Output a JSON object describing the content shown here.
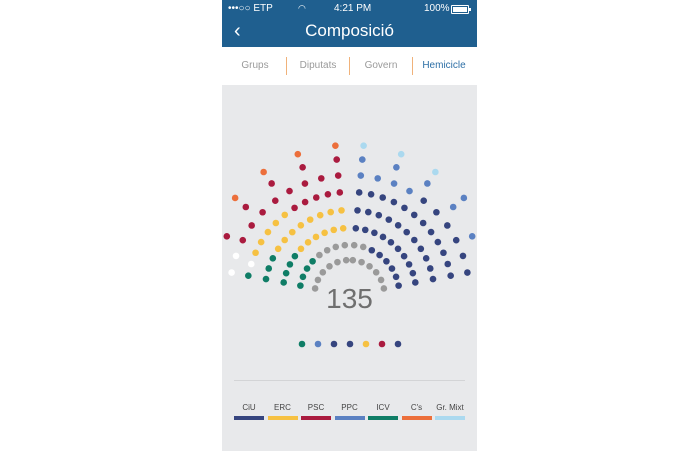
{
  "status_bar": {
    "carrier": "•••○○ ETP",
    "time": "4:21 PM",
    "battery": "100%"
  },
  "header": {
    "title": "Composició"
  },
  "tabs": [
    {
      "label": "Grups",
      "active": false
    },
    {
      "label": "Diputats",
      "active": false
    },
    {
      "label": "Govern",
      "active": false
    },
    {
      "label": "Hemicicle",
      "active": true
    }
  ],
  "hemicycle": {
    "total_seats": "135",
    "colors": {
      "CiU": "#36457f",
      "ERC": "#f6c142",
      "PSC": "#aa1b3f",
      "PPC": "#5b81c2",
      "ICV": "#0f7d66",
      "C's": "#ec6f3b",
      "Gr. Mixt": "#abd9ef",
      "gray": "#9a9a9a",
      "empty": "#ffffff"
    }
  },
  "legend": [
    {
      "label": "CiU",
      "color": "#36457f"
    },
    {
      "label": "ERC",
      "color": "#f6c142"
    },
    {
      "label": "PSC",
      "color": "#aa1b3f"
    },
    {
      "label": "PPC",
      "color": "#5b81c2"
    },
    {
      "label": "ICV",
      "color": "#0f7d66"
    },
    {
      "label": "C's",
      "color": "#ec6f3b"
    },
    {
      "label": "Gr. Mixt",
      "color": "#abd9ef"
    }
  ]
}
